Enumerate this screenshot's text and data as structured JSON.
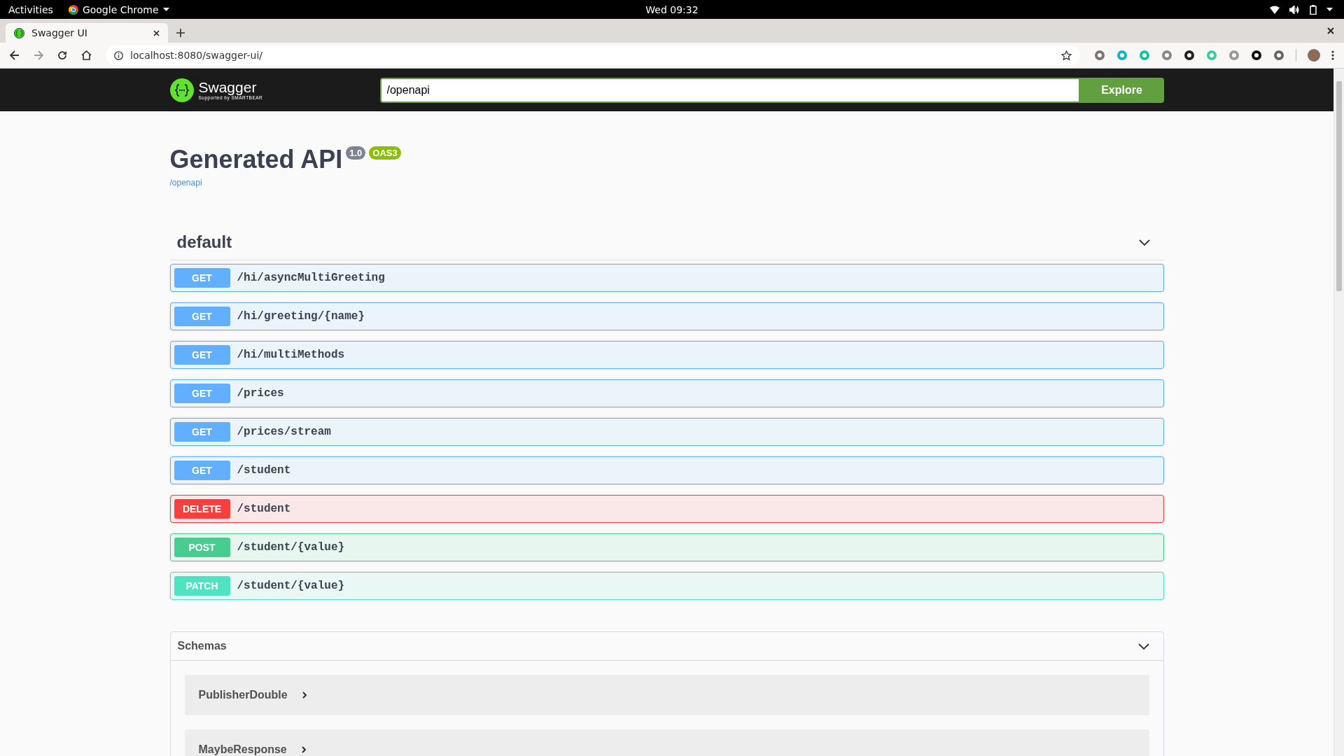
{
  "os_bar": {
    "activities": "Activities",
    "app_name": "Google Chrome",
    "clock": "Wed 09:32"
  },
  "browser": {
    "tabs": [
      {
        "title": "Swagger UI",
        "selected": true
      }
    ],
    "url": "localhost:8080/swagger-ui/"
  },
  "swagger": {
    "logo_text": "Swagger",
    "logo_subtext": "Supported by SMARTBEAR",
    "url_value": "/openapi",
    "explore_label": "Explore"
  },
  "info": {
    "title": "Generated API",
    "version": "1.0",
    "spec": "OAS3",
    "link": "/openapi"
  },
  "section": {
    "name": "default",
    "expanded": true,
    "operations": [
      {
        "kind": "get",
        "method": "GET",
        "path": "/hi/asyncMultiGreeting"
      },
      {
        "kind": "get",
        "method": "GET",
        "path": "/hi/greeting/{name}"
      },
      {
        "kind": "get",
        "method": "GET",
        "path": "/hi/multiMethods"
      },
      {
        "kind": "get",
        "method": "GET",
        "path": "/prices"
      },
      {
        "kind": "get",
        "method": "GET",
        "path": "/prices/stream"
      },
      {
        "kind": "get",
        "method": "GET",
        "path": "/student"
      },
      {
        "kind": "delete",
        "method": "DELETE",
        "path": "/student"
      },
      {
        "kind": "post",
        "method": "POST",
        "path": "/student/{value}"
      },
      {
        "kind": "patch",
        "method": "PATCH",
        "path": "/student/{value}"
      }
    ]
  },
  "schemas": {
    "title": "Schemas",
    "expanded": true,
    "items": [
      {
        "name": "PublisherDouble",
        "expanded": false
      },
      {
        "name": "MaybeResponse",
        "expanded": false
      }
    ]
  }
}
